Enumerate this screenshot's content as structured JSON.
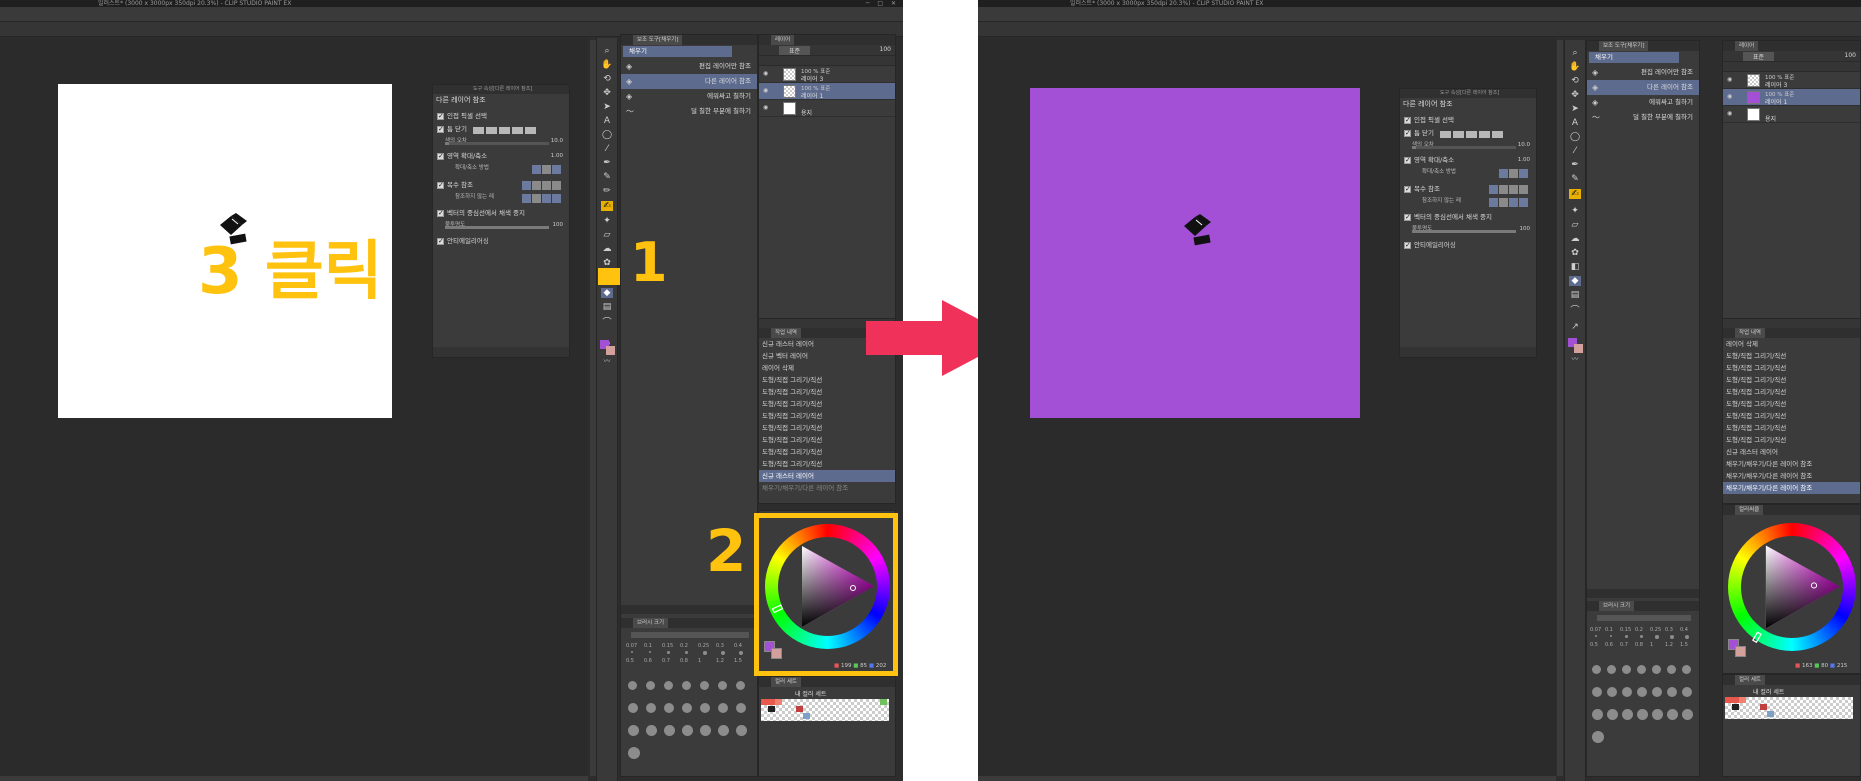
{
  "window": {
    "title": "일러스트* (3000 x 3000px 350dpi 20.3%)  - CLIP STUDIO PAINT EX",
    "controls": "─ □ ✕"
  },
  "tool_options": {
    "header": "도구 속성[다른 레이어 참조]",
    "title": "다른 레이어 참조",
    "adjacent_pixel": "인접 픽셀 선택",
    "close_gap": "틈 닫기",
    "color_margin": "색의 오차",
    "color_margin_value": "10.0",
    "area_scaling": "영역 확대/축소",
    "area_scaling_value": "1.00",
    "scaling_method": "확대/축소 방법",
    "multi_ref": "복수 참조",
    "ref_layer": "참조하지 않는 레",
    "vector_stop": "벡터의 중심선에서 채색 중지",
    "opacity": "불투명도",
    "opacity_value": "100",
    "antialias": "안티에일리어싱"
  },
  "subtool_panel": {
    "tab": "보조 도구[채우기]",
    "group": "채우기",
    "items": [
      {
        "label": "편집 레이어만 참조",
        "icon": "bucket-icon"
      },
      {
        "label": "다른 레이어 참조",
        "icon": "bucket-icon"
      },
      {
        "label": "에워싸고 칠하기",
        "icon": "bucket-icon"
      },
      {
        "label": "덜 칠한 부분에 칠하기",
        "icon": "bucket-icon"
      }
    ]
  },
  "layer_panel": {
    "tab": "레이어",
    "blend_mode": "표준",
    "opacity": "100",
    "left_layers": [
      {
        "pct": "100 % 표준",
        "name": "레이어 3",
        "thumb": "checker"
      },
      {
        "pct": "100 % 표준",
        "name": "레이어 1",
        "thumb": "checker"
      },
      {
        "pct": "",
        "name": "용지",
        "thumb": "white"
      }
    ],
    "right_layers": [
      {
        "pct": "100 % 표준",
        "name": "레이어 3",
        "thumb": "checker"
      },
      {
        "pct": "100 % 표준",
        "name": "레이어 1",
        "thumb": "purple"
      },
      {
        "pct": "",
        "name": "용지",
        "thumb": "white"
      }
    ]
  },
  "history": {
    "tab": "작업 내역",
    "left": [
      "신규 래스터 레이어",
      "신규 벡터 레이어",
      "레이어 삭제",
      "도형/직접 그리기/직선",
      "도형/직접 그리기/직선",
      "도형/직접 그리기/직선",
      "도형/직접 그리기/직선",
      "도형/직접 그리기/직선",
      "도형/직접 그리기/직선",
      "도형/직접 그리기/직선",
      "도형/직접 그리기/직선",
      "신규 래스터 레이어",
      "채우기/채우기/다른 레이어 참조"
    ],
    "right": [
      "레이어 삭제",
      "도형/직접 그리기/직선",
      "도형/직접 그리기/직선",
      "도형/직접 그리기/직선",
      "도형/직접 그리기/직선",
      "도형/직접 그리기/직선",
      "도형/직접 그리기/직선",
      "도형/직접 그리기/직선",
      "도형/직접 그리기/직선",
      "신규 래스터 레이어",
      "채우기/채우기/다른 레이어 참조",
      "채우기/채우기/다른 레이어 참조",
      "채우기/채우기/다른 레이어 참조"
    ]
  },
  "color_wheel": {
    "tab": "컬러써클",
    "left_rgb": {
      "r": "199",
      "g": "85",
      "b": "202"
    },
    "right_rgb": {
      "r": "163",
      "g": "80",
      "b": "215"
    }
  },
  "brush_size": {
    "tab": "브러시 크기",
    "labels": [
      "0.07",
      "0.1",
      "0.15",
      "0.2",
      "0.25",
      "0.3",
      "0.4",
      "0.5",
      "0.6",
      "0.7",
      "0.8",
      "1",
      "1.2",
      "1.5"
    ]
  },
  "color_set": {
    "tab": "컬러 세트",
    "name": "내 컬러 세트"
  },
  "annotations": {
    "step1": "1",
    "step2": "2",
    "step3": "3 클릭"
  },
  "colors": {
    "accent": "#ffc20e",
    "arrow": "#f0325a",
    "fill_result": "#a350d7",
    "selection": "#5d6b8e",
    "paper": "#ffffff"
  }
}
